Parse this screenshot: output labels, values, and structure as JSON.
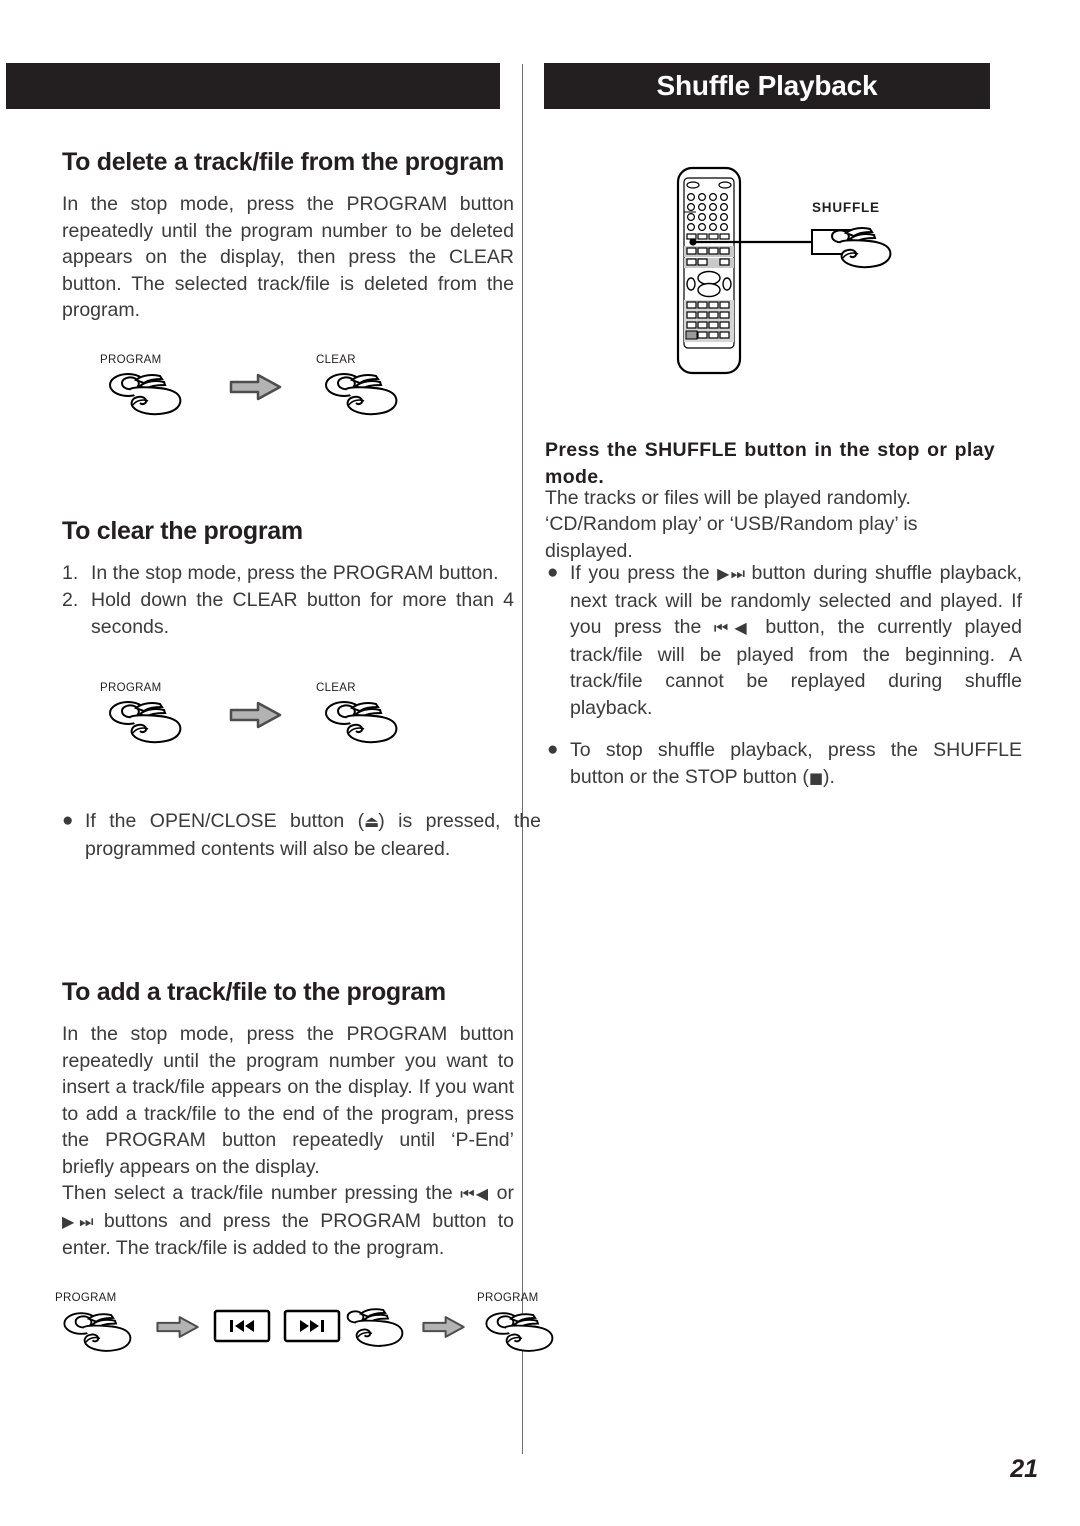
{
  "page": {
    "number": "21",
    "left_header_title": "",
    "right_header_title": "Shuffle Playback"
  },
  "left_column": {
    "section_delete": {
      "title": "To delete a track/file from the program",
      "body": "In the stop mode, press the PROGRAM button repeatedly until the program number to be deleted appears on the display, then press the CLEAR button. The selected track/file is deleted from the program.",
      "icon_sequence": [
        {
          "type": "hand-press",
          "label": "PROGRAM"
        },
        {
          "type": "arrow-right",
          "label": ""
        },
        {
          "type": "hand-press",
          "label": "CLEAR"
        }
      ]
    },
    "section_clear": {
      "title": "To clear the program",
      "steps": [
        {
          "num": "1.",
          "text": "In the stop mode, press the PROGRAM button."
        },
        {
          "num": "2.",
          "text": "Hold down the CLEAR button for more than 4 seconds."
        }
      ],
      "icon_sequence": [
        {
          "type": "hand-press",
          "label": "PROGRAM"
        },
        {
          "type": "arrow-right",
          "label": ""
        },
        {
          "type": "hand-press",
          "label": "CLEAR"
        }
      ],
      "note_bullet": "●",
      "note_part1": "If the OPEN/CLOSE button (",
      "note_symbol": "⏏",
      "note_part2": ") is pressed, the programmed contents will also be cleared."
    },
    "section_add": {
      "title": "To add a track/file to the program",
      "body1": "In the stop mode, press the PROGRAM button repeatedly until the program number you want to insert a track/file appears on the display. If you want to add a track/file to the end of the program, press the PROGRAM button repeatedly until ‘P-End’ briefly appears on the display.",
      "body2_part1": "Then select a track/file number pressing the ",
      "body2_skip_back": "⏮◀",
      "body2_part2": " or ",
      "body2_skip_fwd": "▶⏭",
      "body2_part3": " buttons and press the PROGRAM button to enter. The track/file is added to the program.",
      "icon_sequence": [
        {
          "type": "hand-press",
          "label": "PROGRAM"
        },
        {
          "type": "arrow-right",
          "label": ""
        },
        {
          "type": "key-box",
          "label": "",
          "glyph": "skip-back"
        },
        {
          "type": "key-box-hand",
          "label": "",
          "glyph": "skip-forward"
        },
        {
          "type": "arrow-right",
          "label": ""
        },
        {
          "type": "hand-press",
          "label": "PROGRAM"
        }
      ]
    }
  },
  "right_column": {
    "remote": {
      "callout_label": "SHUFFLE",
      "callout_button_name": "shuffle-button"
    },
    "instruction_bold": "Press the SHUFFLE button in the stop or play mode.",
    "line1": "The tracks or files will be played randomly.",
    "line2": "‘CD/Random play’ or ‘USB/Random play’ is displayed.",
    "bullets": [
      {
        "marker": "●",
        "part1": "If you press the ",
        "sym1": "▶⏭",
        "part2": " button during shuffle playback, next track will be randomly selected and played. If you press the ",
        "sym2": "⏮◀",
        "part3": " button, the currently played track/file will be played from the beginning. A track/file cannot be replayed during shuffle playback."
      },
      {
        "marker": "●",
        "part1": "To stop shuffle playback, press the SHUFFLE button or the STOP button (",
        "sym1": "■",
        "part2": ").",
        "sym2": "",
        "part3": ""
      }
    ]
  }
}
